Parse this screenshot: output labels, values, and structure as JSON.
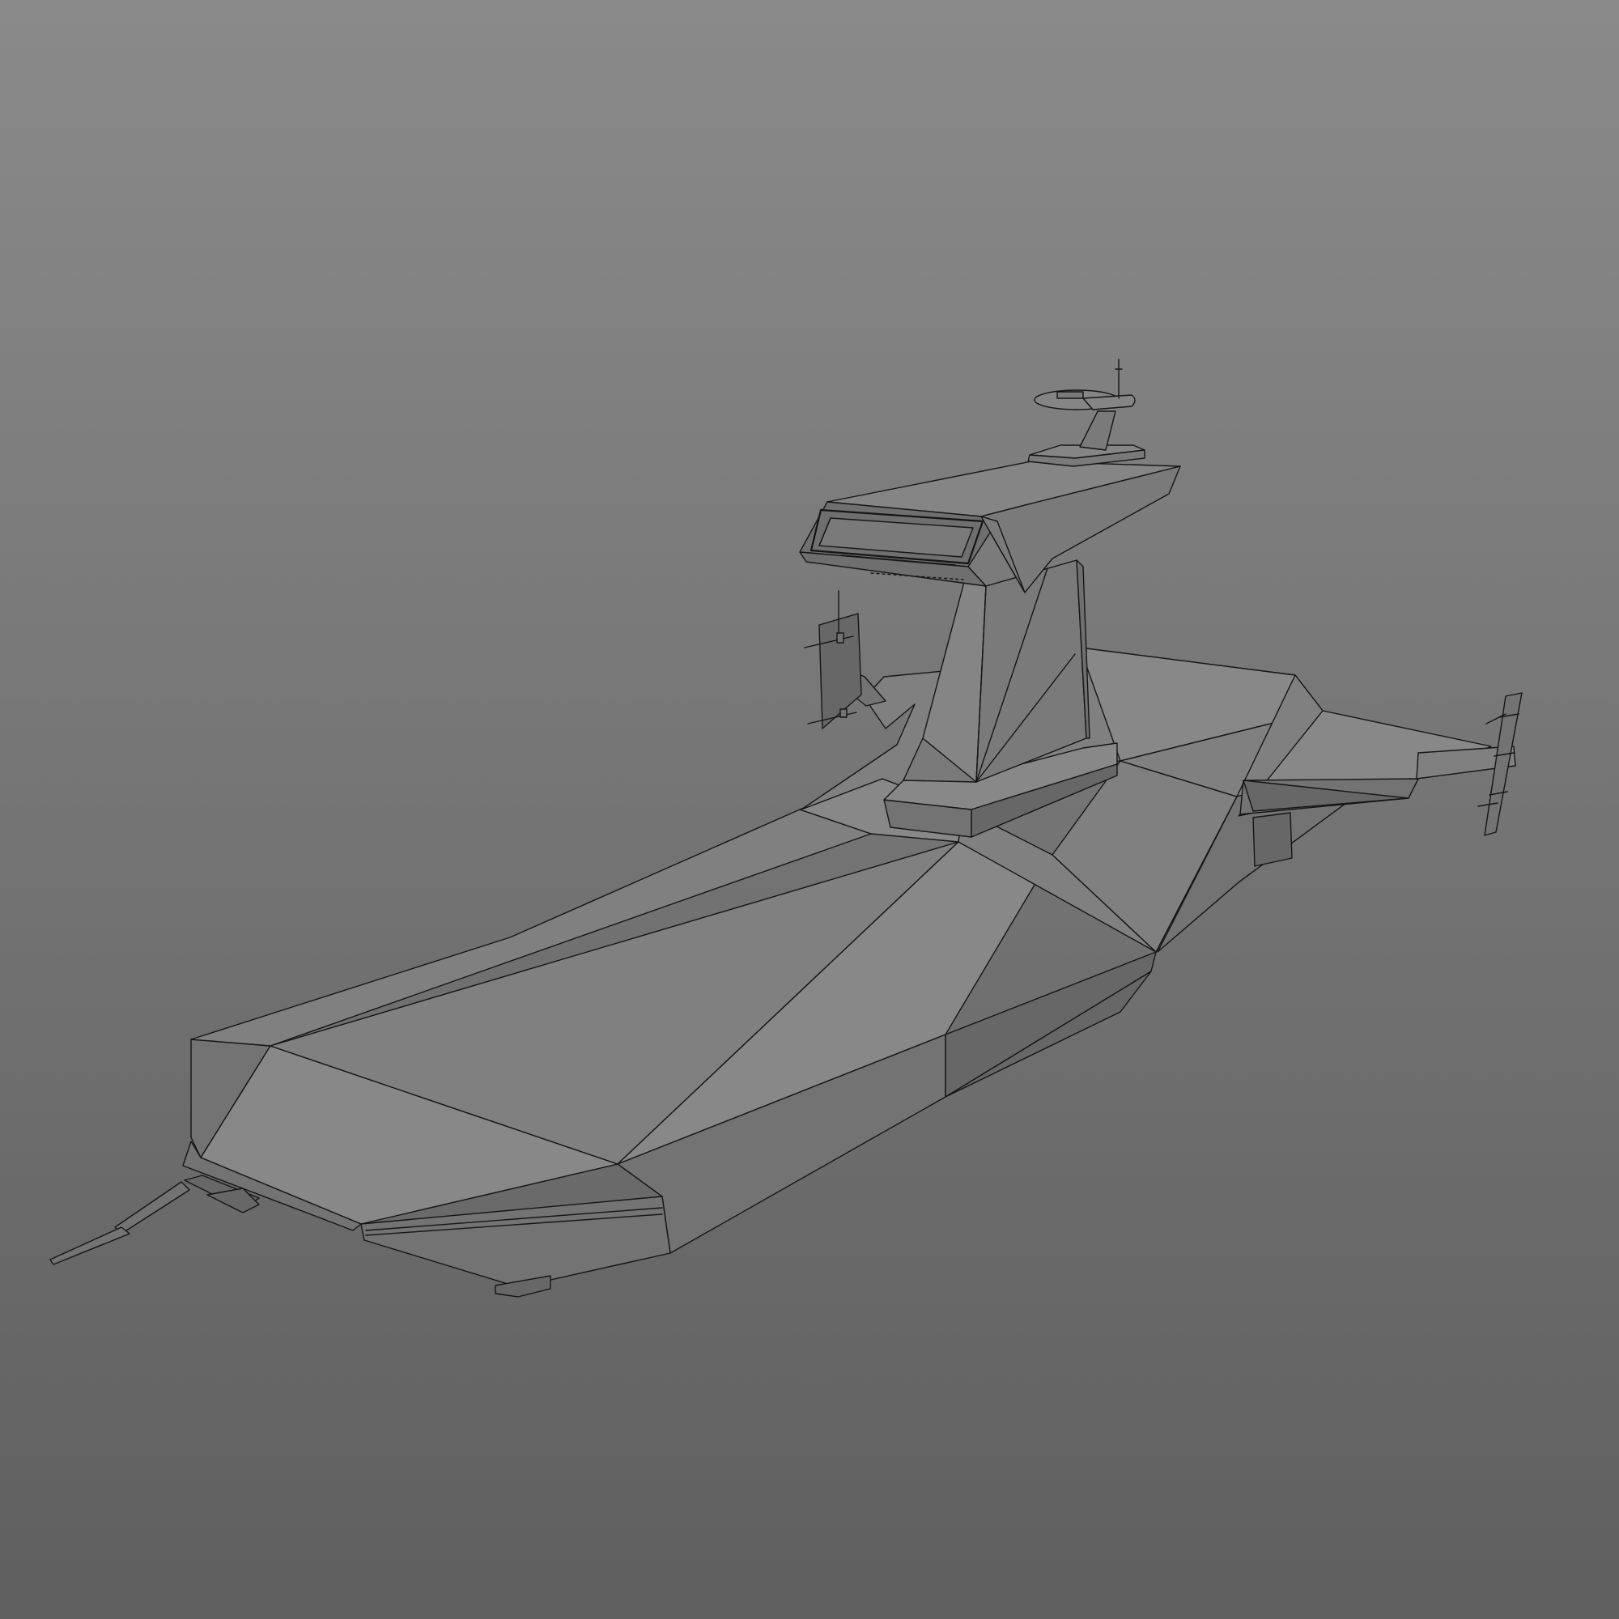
{
  "viewport": {
    "background_top": "#8a8a8a",
    "background_bottom": "#5f5f5f",
    "edge_color": "#151515"
  },
  "shading": {
    "deck": "#808080",
    "deck_light": "#888888",
    "side": "#737373",
    "side_dark": "#676767",
    "tower": "#7a7a7a",
    "tower_dark": "#6f6f6f",
    "tower_light": "#858585"
  }
}
